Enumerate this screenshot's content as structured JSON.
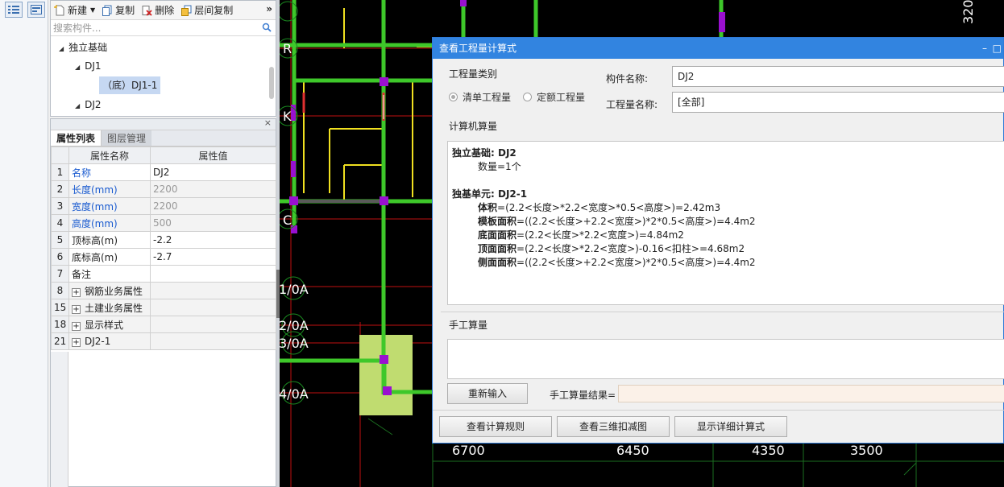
{
  "component_panel": {
    "toolbar": {
      "new_label": "新建",
      "copy_label": "复制",
      "delete_label": "删除",
      "floor_copy_label": "层间复制",
      "more_label": "»"
    },
    "search": {
      "placeholder": "搜索构件..."
    },
    "tree": {
      "root": "独立基础",
      "dj1": "DJ1",
      "dj1_child": "（底）DJ1-1",
      "dj2": "DJ2"
    }
  },
  "property_panel": {
    "close_label": "×",
    "tabs": [
      "属性列表",
      "图层管理"
    ],
    "columns": {
      "name": "属性名称",
      "value": "属性值"
    },
    "rows": [
      {
        "num": "1",
        "name": "名称",
        "value": "DJ2"
      },
      {
        "num": "2",
        "name": "长度(mm)",
        "value": "2200"
      },
      {
        "num": "3",
        "name": "宽度(mm)",
        "value": "2200"
      },
      {
        "num": "4",
        "name": "高度(mm)",
        "value": "500"
      },
      {
        "num": "5",
        "name": "顶标高(m)",
        "value": "-2.2"
      },
      {
        "num": "6",
        "name": "底标高(m)",
        "value": "-2.7"
      },
      {
        "num": "7",
        "name": "备注",
        "value": ""
      },
      {
        "num": "8",
        "name": "钢筋业务属性",
        "value": ""
      },
      {
        "num": "15",
        "name": "土建业务属性",
        "value": ""
      },
      {
        "num": "18",
        "name": "显示样式",
        "value": ""
      },
      {
        "num": "21",
        "name": "DJ2-1",
        "value": ""
      }
    ]
  },
  "cad": {
    "axis_labels": {
      "r": "R",
      "k": "K",
      "c": "C",
      "a1": "1/0A",
      "a2": "2/0A",
      "a3": "3/0A",
      "a4": "4/0A"
    },
    "dimensions": {
      "d1": "6700",
      "d2": "6450",
      "d3": "4350",
      "d4": "3500",
      "top": "320"
    }
  },
  "dialog": {
    "title": "查看工程量计算式",
    "minimize": "–",
    "maximize": "□",
    "qty_type_label": "工程量类别",
    "radio_qd": "清单工程量",
    "radio_de": "定额工程量",
    "component_name_label": "构件名称:",
    "component_name_value": "DJ2",
    "qty_name_label": "工程量名称:",
    "qty_name_value": "[全部]",
    "computer_calc_label": "计算机算量",
    "calc": {
      "header1": "独立基础: DJ2",
      "count": "数量=1个",
      "header2": "独基单元: DJ2-1",
      "lines": [
        {
          "key": "体积",
          "expr": "=(2.2<长度>*2.2<宽度>*0.5<高度>)=2.42m3"
        },
        {
          "key": "模板面积",
          "expr": "=((2.2<长度>+2.2<宽度>)*2*0.5<高度>)=4.4m2"
        },
        {
          "key": "底面面积",
          "expr": "=(2.2<长度>*2.2<宽度>)=4.84m2"
        },
        {
          "key": "顶面面积",
          "expr": "=(2.2<长度>*2.2<宽度>)-0.16<扣柱>=4.68m2"
        },
        {
          "key": "侧面面积",
          "expr": "=((2.2<长度>+2.2<宽度>)*2*0.5<高度>)=4.4m2"
        }
      ]
    },
    "manual_label": "手工算量",
    "reinput_button": "重新输入",
    "manual_result_label": "手工算量结果=",
    "btn_rules": "查看计算规则",
    "btn_3d": "查看三维扣减图",
    "btn_detail": "显示详细计算式"
  }
}
